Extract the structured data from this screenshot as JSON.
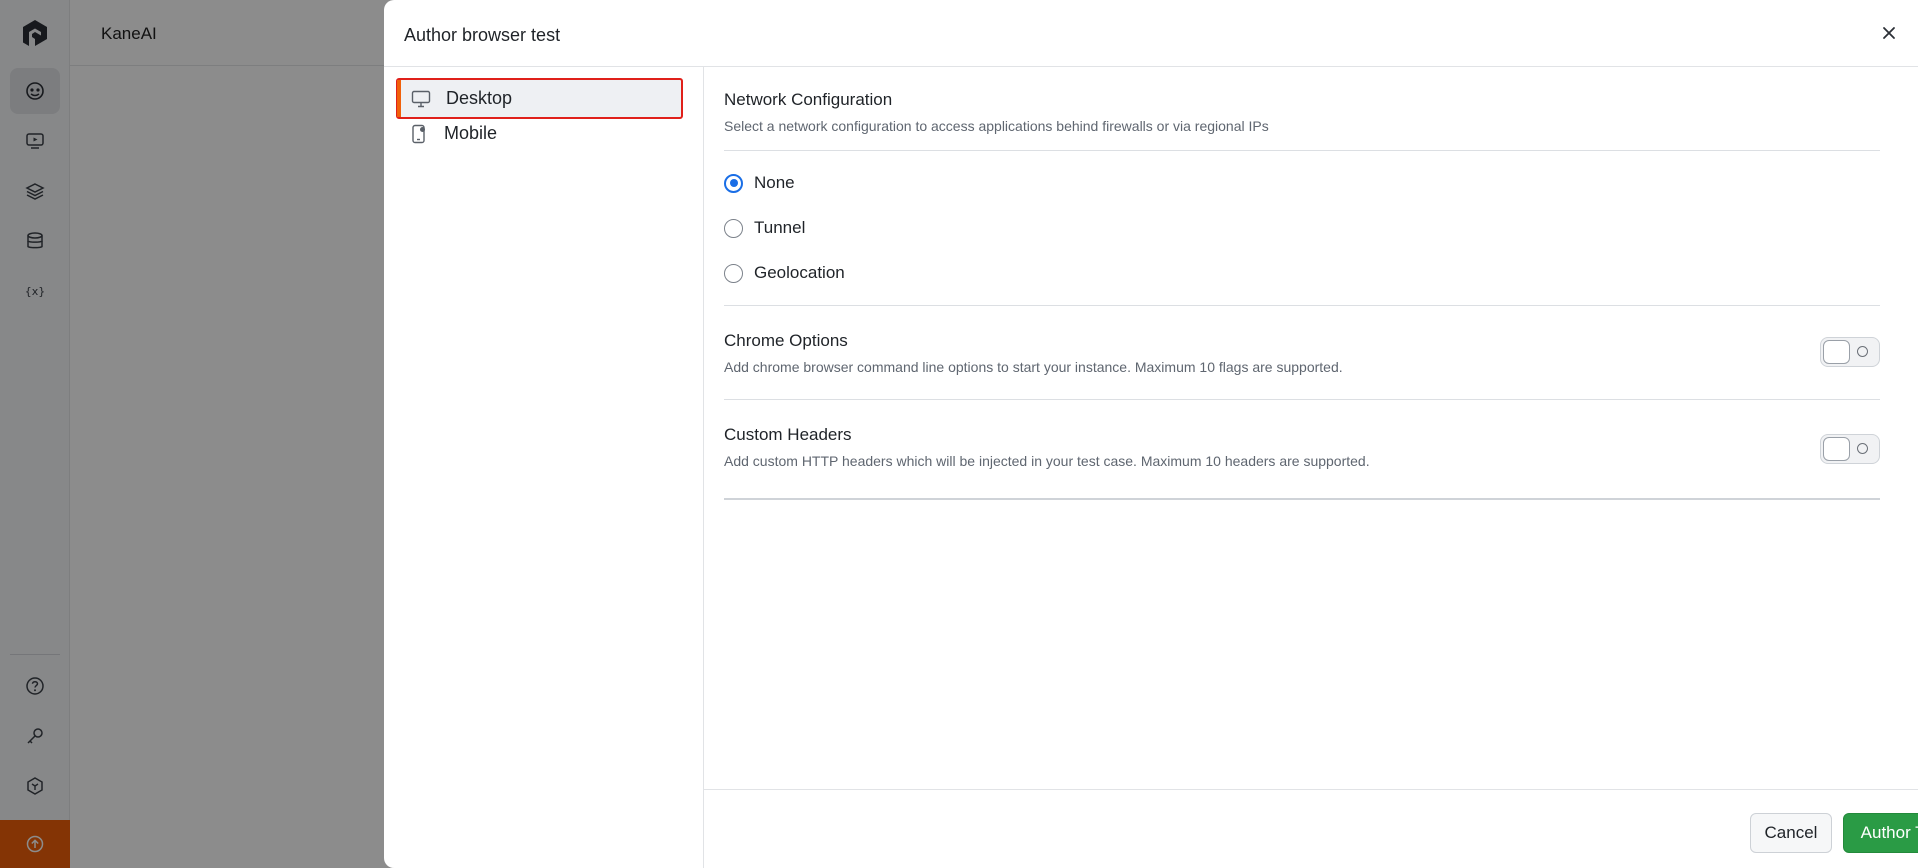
{
  "app": {
    "title": "KaneAI"
  },
  "modal": {
    "title": "Author browser test",
    "close_icon": "close-icon"
  },
  "sidebar": {
    "items": [
      {
        "label": "Desktop",
        "icon": "desktop-icon",
        "selected": true
      },
      {
        "label": "Mobile",
        "icon": "mobile-icon",
        "selected": false
      }
    ]
  },
  "network": {
    "title": "Network Configuration",
    "description": "Select a network configuration to access applications behind firewalls or via regional IPs",
    "options": [
      {
        "label": "None",
        "checked": true
      },
      {
        "label": "Tunnel",
        "checked": false
      },
      {
        "label": "Geolocation",
        "checked": false
      }
    ]
  },
  "chrome_options": {
    "title": "Chrome Options",
    "description": "Add chrome browser command line options to start your instance. Maximum 10 flags are supported.",
    "enabled": false
  },
  "custom_headers": {
    "title": "Custom Headers",
    "description": "Add custom HTTP headers which will be injected in your test case. Maximum 10 headers are supported.",
    "enabled": false
  },
  "footer": {
    "cancel_label": "Cancel",
    "submit_label": "Author Test"
  },
  "colors": {
    "primary": "#2a9b45",
    "accent": "#f0600a",
    "radio_checked": "#1a6ee6",
    "highlight_border": "#e0201a"
  }
}
